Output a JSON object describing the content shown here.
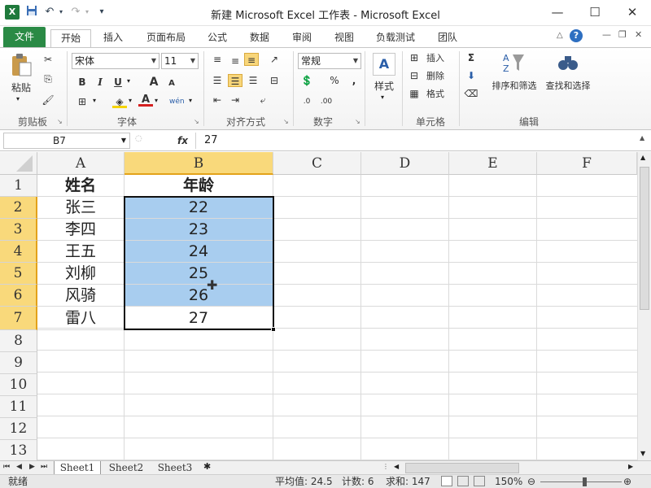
{
  "window": {
    "title": "新建 Microsoft Excel 工作表 - Microsoft Excel",
    "controls": {
      "minimize": "—",
      "maximize": "☐",
      "close": "✕"
    }
  },
  "quick_access": {
    "app_icon": "X",
    "save": "💾",
    "undo": "↶",
    "redo": "↷",
    "customize": "▾"
  },
  "tabs": {
    "file": "文件",
    "items": [
      "开始",
      "插入",
      "页面布局",
      "公式",
      "数据",
      "审阅",
      "视图",
      "负载测试",
      "团队"
    ],
    "active": "开始"
  },
  "ribbon": {
    "clipboard": {
      "label": "剪贴板",
      "paste": "粘贴"
    },
    "font": {
      "label": "字体",
      "name": "宋体",
      "size": "11",
      "bold": "B",
      "italic": "I",
      "underline": "U",
      "grow": "A",
      "shrink": "A",
      "fontcolor": "A",
      "wen": "wén"
    },
    "align": {
      "label": "对齐方式"
    },
    "number": {
      "label": "数字",
      "format": "常规",
      "percent": "%",
      "comma": ",",
      "inc": ".0",
      "dec": ".00"
    },
    "styles": {
      "label": "样式"
    },
    "cells": {
      "label": "单元格",
      "insert": "插入",
      "delete": "删除",
      "format": "格式"
    },
    "editing": {
      "label": "编辑",
      "sum": "Σ",
      "sort": "排序和筛选",
      "find": "查找和选择"
    }
  },
  "formula_bar": {
    "name_box": "B7",
    "fx": "fx",
    "content": "27"
  },
  "columns": [
    "A",
    "B",
    "C",
    "D",
    "E",
    "F"
  ],
  "rows": [
    "1",
    "2",
    "3",
    "4",
    "5",
    "6",
    "7",
    "8",
    "9",
    "10",
    "11",
    "12",
    "13"
  ],
  "cells": {
    "A": [
      "姓名",
      "张三",
      "李四",
      "王五",
      "刘柳",
      "风骑",
      "雷八"
    ],
    "B": [
      "年龄",
      "22",
      "23",
      "24",
      "25",
      "26",
      "27"
    ]
  },
  "sheets": [
    "Sheet1",
    "Sheet2",
    "Sheet3"
  ],
  "status": {
    "ready": "就绪",
    "average": "平均值: 24.5",
    "count": "计数: 6",
    "sum": "求和: 147",
    "zoom": "150%"
  },
  "colors": {
    "accent_green": "#2a8a45",
    "selection_fill": "#a8cdef",
    "header_selected": "#f9d97b"
  }
}
